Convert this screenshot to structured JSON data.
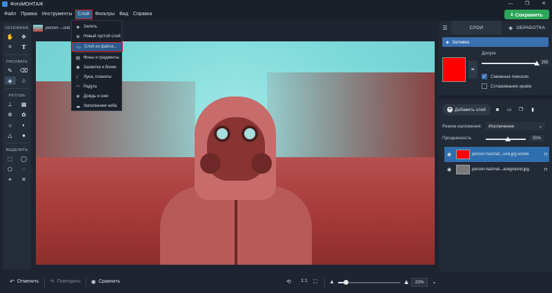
{
  "app": {
    "title": "ФотоМОНТАЖ",
    "window_controls": [
      "—",
      "❐",
      "✕"
    ]
  },
  "menu": {
    "items": [
      "Файл",
      "Правка",
      "Инструменты",
      "Слой",
      "Фильтры",
      "Вид",
      "Справка"
    ],
    "active_index": 3
  },
  "save_button": {
    "label": "Сохранить",
    "color": "#2ea65a"
  },
  "document_tab": {
    "name": "person-...und"
  },
  "left_toolbar": {
    "sections": [
      "ОСНОВНЫЕ",
      "РИСОВАТЬ",
      "РЕТУШЬ",
      "ВЫДЕЛИТЬ"
    ],
    "icons": {
      "basic": [
        "hand-icon",
        "move-icon",
        "crop-icon",
        "text-icon"
      ],
      "draw": [
        "brush-icon",
        "eraser-icon",
        "fill-icon",
        "shapes-icon"
      ],
      "retouch": [
        "stamp-icon",
        "patch-icon",
        "sharpen-icon",
        "flower-icon",
        "brightness-icon",
        "dodge-icon",
        "triangle-icon",
        "drop-icon"
      ],
      "select": [
        "rect-select-icon",
        "lasso-icon",
        "poly-lasso-icon",
        "ellipse-select-icon",
        "magic-wand-icon",
        "tools-icon"
      ]
    }
  },
  "dropdown": {
    "items": [
      {
        "label": "Залить",
        "icon": "fill-icon"
      },
      {
        "label": "Новый пустой слой",
        "icon": "plus-icon"
      },
      {
        "label": "Слой из файла...",
        "icon": "folder-icon",
        "highlighted": true
      },
      {
        "label": "Фоны и градиенты",
        "icon": "gradient-icon"
      },
      {
        "label": "Засветки и блики",
        "icon": "flare-icon"
      },
      {
        "label": "Луна, планеты",
        "icon": "moon-icon"
      },
      {
        "label": "Радуга",
        "icon": "rainbow-icon"
      },
      {
        "label": "Дождь и снег",
        "icon": "snow-icon"
      },
      {
        "label": "Заполнение неба",
        "icon": "cloud-icon"
      }
    ]
  },
  "bottom": {
    "undo": "Отменить",
    "redo": "Повторить",
    "compare": "Сравнить",
    "ratio": "1:1",
    "zoom_value": "23%",
    "zoom_fraction": 0.12
  },
  "right_panel": {
    "tabs": [
      "СЛОИ",
      "ОБРАБОТКА"
    ],
    "active_tab": 0,
    "fill_title": "Заливка",
    "tolerance_label": "Допуск",
    "tolerance_value": "255",
    "tolerance_fraction": 1.0,
    "fill_color": "#ff0000",
    "contiguous_label": "Смежные пиксели",
    "contiguous_checked": true,
    "antialias_label": "Сглаживание краёв",
    "antialias_checked": false,
    "add_layer_label": "Добавить слой",
    "blend_label": "Режим наложения:",
    "blend_value": "Исключение",
    "opacity_label": "Прозрачность",
    "opacity_value": "55%",
    "opacity_fraction": 0.55,
    "layers": [
      {
        "name": "person-hazmat...und.jpg копия",
        "active": true,
        "thumb_color": "#ff0000"
      },
      {
        "name": "person-hazmat...ackground.jpg",
        "active": false,
        "thumb_color": "#7a7a7a"
      }
    ]
  }
}
